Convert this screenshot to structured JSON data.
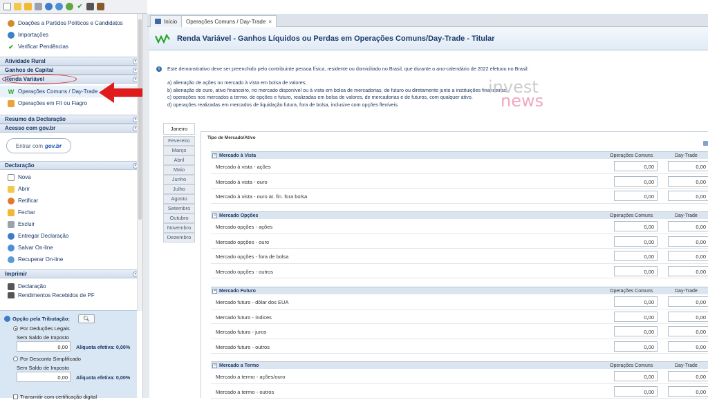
{
  "toolbar": {
    "icons": [
      "new-file-icon",
      "open-folder-icon",
      "folder-icon",
      "trash-icon",
      "globe-icon",
      "globe-sync-icon",
      "update-icon",
      "check-icon",
      "print-icon",
      "book-icon"
    ]
  },
  "sidebar": {
    "top_items": [
      {
        "label": "Doações a Partidos Políticos e Candidatos",
        "icon": "people-icon"
      },
      {
        "label": "Importações",
        "icon": "import-icon"
      },
      {
        "label": "Verificar Pendências",
        "icon": "check-icon"
      }
    ],
    "sections": {
      "atividade_rural": "Atividade Rural",
      "ganhos_capital": "Ganhos de Capital",
      "renda_variavel": "Renda Variável",
      "resumo": "Resumo da Declaração",
      "acesso": "Acesso com gov.br",
      "declaracao": "Declaração",
      "imprimir": "Imprimir"
    },
    "renda_items": [
      {
        "label": "Operações Comuns / Day-Trade"
      },
      {
        "label": "Operações em FII ou Fiagro"
      }
    ],
    "gov": {
      "prefix": "Entrar com",
      "brand": "gov.br"
    },
    "declaracao_items": [
      "Nova",
      "Abrir",
      "Retificar",
      "Fechar",
      "Excluir",
      "Entregar Declaração",
      "Salvar On-line",
      "Recuperar On-line"
    ],
    "imprimir_items": [
      "Declaração",
      "Rendimentos Recebidos de PF"
    ]
  },
  "opcao": {
    "title": "Opção pela Tributação:",
    "opt1": "Por Deduções Legais",
    "opt1_sub": "Sem Saldo de Imposto",
    "opt1_value": "0,00",
    "opt1_aliquota": "Alíquota efetiva: 0,00%",
    "opt2": "Por Desconto Simplificado",
    "opt2_sub": "Sem Saldo de Imposto",
    "opt2_value": "0,00",
    "opt2_aliquota": "Alíquota efetiva: 0,00%",
    "transmit": "Transmitir com certificação digital"
  },
  "tabs": [
    {
      "label": "Início"
    },
    {
      "label": "Operações Comuns / Day-Trade",
      "close": "×"
    }
  ],
  "header": {
    "title": "Renda Variável - Ganhos Líquidos ou Perdas em Operações Comuns/Day-Trade - Titular"
  },
  "info": {
    "intro": "Este demonstrativo deve ser preenchido pelo contribuinte pessoa física, residente ou domiciliado no Brasil, que durante o ano-calendário de 2022 efetuou no Brasil:",
    "a": "a) alienação de ações no mercado à vista em bolsa de valores;",
    "b": "b) alienação de ouro, ativo financeiro, no mercado disponível ou à vista em bolsa de mercadorias, de futuro ou diretamente junto a instituições financeiras;",
    "c": "c) operações nos mercados a termo, de opções e futuro, realizadas em bolsa de valores, de mercadorias e de futuros, com qualquer ativo.",
    "d": "d) operações realizadas em mercados de liquidação futura, fora de bolsa, inclusive com opções flexíveis."
  },
  "watermark": {
    "line1": "invest",
    "line2": "news"
  },
  "months": [
    "Janeiro",
    "Fevereiro",
    "Março",
    "Abril",
    "Maio",
    "Junho",
    "Julho",
    "Agosto",
    "Setembro",
    "Outubro",
    "Novembro",
    "Dezembro"
  ],
  "panel_title": "Tipo de Mercado/Ativo",
  "col_labels": {
    "c1": "Operações Comuns",
    "c2": "Day-Trade"
  },
  "groups": [
    {
      "title": "Mercado à Vista",
      "rows": [
        {
          "label": "Mercado à vista - ações",
          "v1": "0,00",
          "v2": "0,00"
        },
        {
          "label": "Mercado à vista - ouro",
          "v1": "0,00",
          "v2": "0,00"
        },
        {
          "label": "Mercado à vista - ouro at. fin. fora bolsa",
          "v1": "0,00",
          "v2": "0,00"
        }
      ]
    },
    {
      "title": "Mercado Opções",
      "rows": [
        {
          "label": "Mercado opções - ações",
          "v1": "0,00",
          "v2": "0,00"
        },
        {
          "label": "Mercado opções - ouro",
          "v1": "0,00",
          "v2": "0,00"
        },
        {
          "label": "Mercado opções - fora de bolsa",
          "v1": "0,00",
          "v2": "0,00"
        },
        {
          "label": "Mercado opções - outros",
          "v1": "0,00",
          "v2": "0,00"
        }
      ]
    },
    {
      "title": "Mercado Futuro",
      "rows": [
        {
          "label": "Mercado futuro - dólar dos EUA",
          "v1": "0,00",
          "v2": "0,00"
        },
        {
          "label": "Mercado futuro - índices",
          "v1": "0,00",
          "v2": "0,00"
        },
        {
          "label": "Mercado futuro - juros",
          "v1": "0,00",
          "v2": "0,00"
        },
        {
          "label": "Mercado futuro - outros",
          "v1": "0,00",
          "v2": "0,00"
        }
      ]
    },
    {
      "title": "Mercado a Termo",
      "rows": [
        {
          "label": "Mercado a termo - ações/ouro",
          "v1": "0,00",
          "v2": "0,00"
        },
        {
          "label": "Mercado a termo - outros",
          "v1": "0,00",
          "v2": "0,00"
        }
      ]
    }
  ],
  "colors": {
    "accent": "#1c3a66",
    "annotation": "#d62020",
    "check": "#2aa52a"
  }
}
